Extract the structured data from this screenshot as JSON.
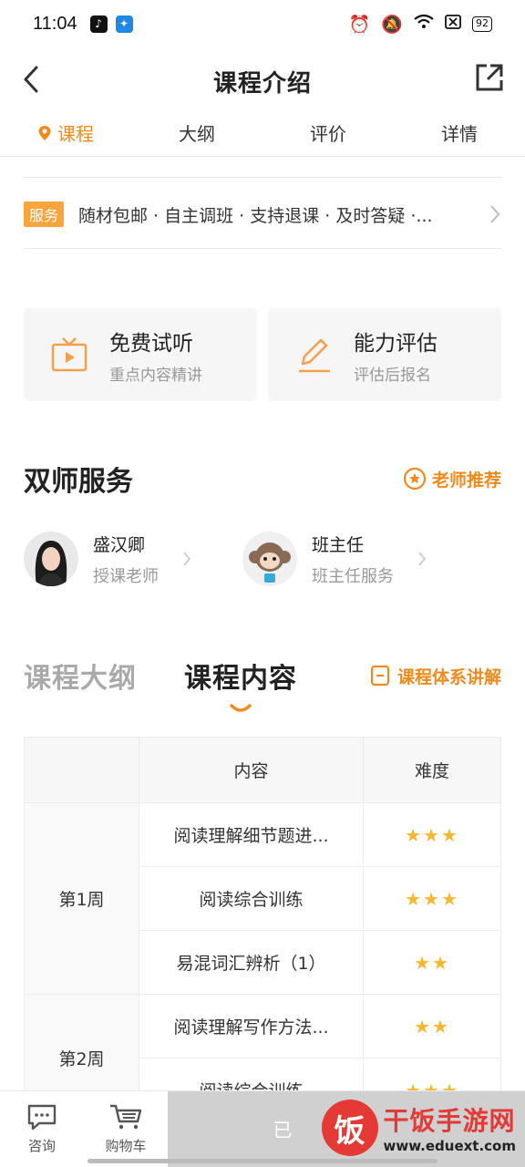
{
  "status_bar": {
    "time": "11:04",
    "battery": "92"
  },
  "nav": {
    "title": "课程介绍"
  },
  "tabs": [
    {
      "label": "课程"
    },
    {
      "label": "大纲"
    },
    {
      "label": "评价"
    },
    {
      "label": "详情"
    }
  ],
  "service": {
    "badge": "服务",
    "text": "随材包邮 · 自主调班 · 支持退课 · 及时答疑 ·..."
  },
  "cards": [
    {
      "title": "免费试听",
      "subtitle": "重点内容精讲"
    },
    {
      "title": "能力评估",
      "subtitle": "评估后报名"
    }
  ],
  "teachers_section": {
    "title": "双师服务",
    "recommend": "老师推荐",
    "teachers": [
      {
        "name": "盛汉卿",
        "role": "授课老师"
      },
      {
        "name": "班主任",
        "role": "班主任服务"
      }
    ]
  },
  "outline": {
    "tab_outline": "课程大纲",
    "tab_content": "课程内容",
    "explain": "课程体系讲解",
    "table": {
      "headers": [
        "内容",
        "难度"
      ],
      "rows": [
        {
          "week": "第1周",
          "items": [
            {
              "content": "阅读理解细节题进...",
              "stars": "★★★"
            },
            {
              "content": "阅读综合训练",
              "stars": "★★★"
            },
            {
              "content": "易混词汇辨析（1）",
              "stars": "★★"
            }
          ]
        },
        {
          "week": "第2周",
          "items": [
            {
              "content": "阅读理解写作方法...",
              "stars": "★★"
            },
            {
              "content": "阅读综合训练",
              "stars": "★★★"
            }
          ]
        }
      ]
    }
  },
  "bottom_bar": {
    "consult": "咨询",
    "cart": "购物车",
    "main_button": "已"
  },
  "watermark": {
    "logo": "饭",
    "title": "干饭手游网",
    "url": "www.eduext.com"
  }
}
